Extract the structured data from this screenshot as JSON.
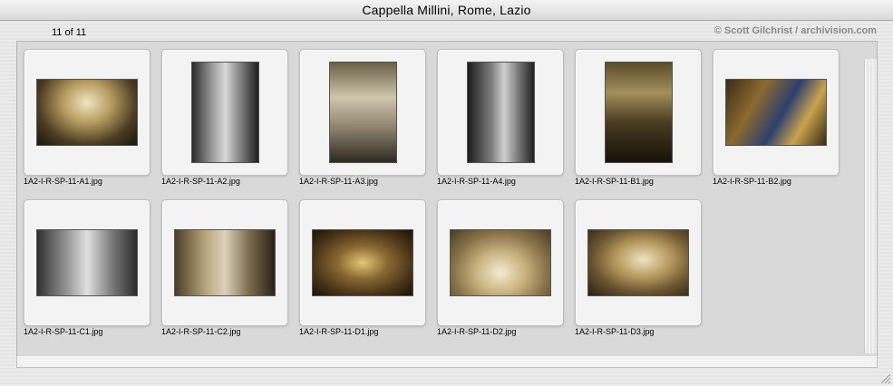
{
  "window": {
    "title": "Cappella Millini, Rome, Lazio"
  },
  "gallery": {
    "counter": "11 of 11",
    "copyright": "© Scott Gilchrist / archivision.com",
    "images": [
      {
        "filename": "1A2-I-R-SP-11-A1.jpg"
      },
      {
        "filename": "1A2-I-R-SP-11-A2.jpg"
      },
      {
        "filename": "1A2-I-R-SP-11-A3.jpg"
      },
      {
        "filename": "1A2-I-R-SP-11-A4.jpg"
      },
      {
        "filename": "1A2-I-R-SP-11-B1.jpg"
      },
      {
        "filename": "1A2-I-R-SP-11-B2.jpg"
      },
      {
        "filename": "1A2-I-R-SP-11-C1.jpg"
      },
      {
        "filename": "1A2-I-R-SP-11-C2.jpg"
      },
      {
        "filename": "1A2-I-R-SP-11-D1.jpg"
      },
      {
        "filename": "1A2-I-R-SP-11-D2.jpg"
      },
      {
        "filename": "1A2-I-R-SP-11-D3.jpg"
      }
    ]
  }
}
